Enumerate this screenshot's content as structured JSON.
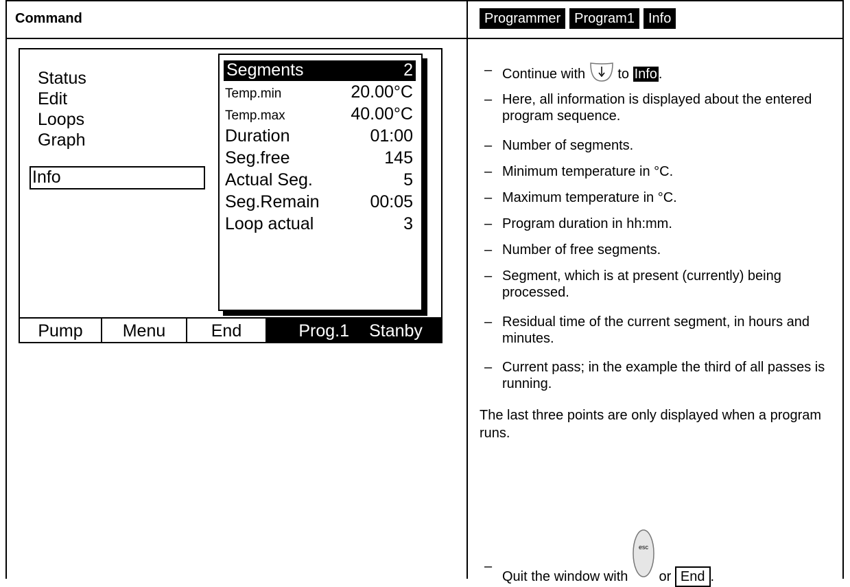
{
  "header": {
    "title": "Command",
    "breadcrumb": [
      "Programmer",
      "Program1",
      "Info"
    ]
  },
  "device": {
    "menu": [
      "Status",
      "Edit",
      "Loops",
      "Graph",
      "Info"
    ],
    "selected_menu": "Info",
    "info_rows": [
      {
        "label": "Segments",
        "value": "2"
      },
      {
        "label": "Temp.min",
        "value": "20.00°C"
      },
      {
        "label": "Temp.max",
        "value": "40.00°C"
      },
      {
        "label": "Duration",
        "value": "01:00"
      },
      {
        "label": "Seg.free",
        "value": "145"
      },
      {
        "label": "Actual Seg.",
        "value": "5"
      },
      {
        "label": "Seg.Remain",
        "value": "00:05"
      },
      {
        "label": "Loop actual",
        "value": "3"
      }
    ],
    "softkeys": [
      "Pump",
      "Menu",
      "End",
      "Prog.1",
      "Stanby"
    ]
  },
  "instructions": {
    "step1_pre": "Continue with",
    "step1_mid": "to",
    "step1_hl": "Info",
    "step1_post": ".",
    "steps": [
      "Here, all information is displayed about the entered program sequence.",
      "Number of segments.",
      "Minimum temperature in °C.",
      "Maximum temperature in °C.",
      "Program duration in hh:mm.",
      "Number of free segments.",
      "Segment, which is at present (currently) being processed.",
      "Residual time of the current segment, in hours and minutes.",
      "Current pass; in the example the third of all passes is running."
    ],
    "note": "The last three points are only displayed when a program runs.",
    "quit_pre": "Quit the window with",
    "quit_mid": "or",
    "quit_btn": "End",
    "quit_post": ".",
    "esc_key_label": "esc",
    "dash": "–"
  }
}
